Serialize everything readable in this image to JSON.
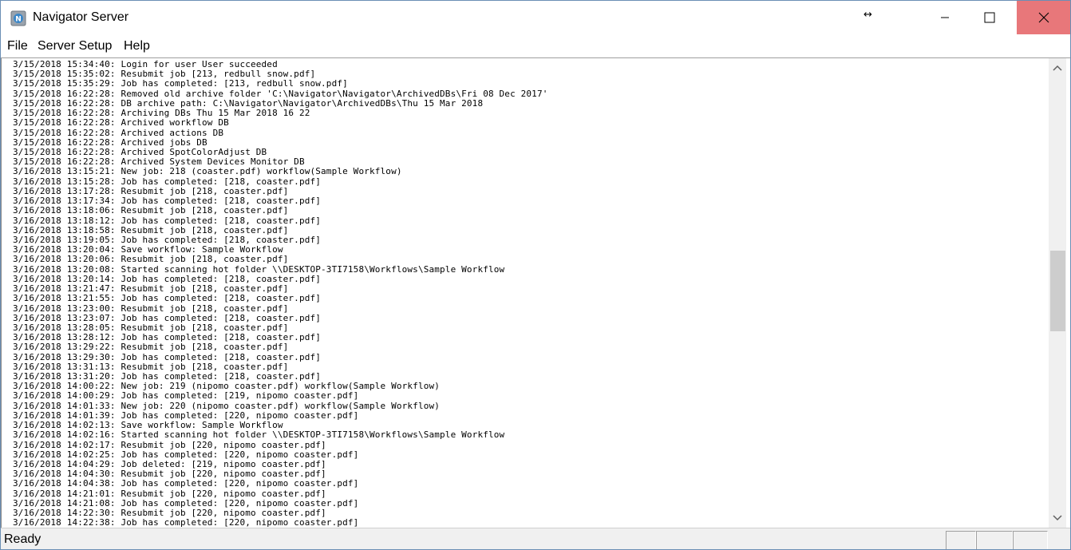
{
  "window": {
    "title": "Navigator Server"
  },
  "menu": {
    "items": [
      "File",
      "Server Setup",
      "Help"
    ]
  },
  "log": {
    "lines": [
      "3/15/2018 15:34:40: Login for user User succeeded",
      "3/15/2018 15:35:02: Resubmit job [213, redbull snow.pdf]",
      "3/15/2018 15:35:29: Job has completed: [213, redbull snow.pdf]",
      "3/15/2018 16:22:28: Removed old archive folder 'C:\\Navigator\\Navigator\\ArchivedDBs\\Fri 08 Dec 2017'",
      "3/15/2018 16:22:28: DB archive path: C:\\Navigator\\Navigator\\ArchivedDBs\\Thu 15 Mar 2018",
      "3/15/2018 16:22:28: Archiving DBs Thu 15 Mar 2018 16 22",
      "3/15/2018 16:22:28: Archived workflow DB",
      "3/15/2018 16:22:28: Archived actions DB",
      "3/15/2018 16:22:28: Archived jobs DB",
      "3/15/2018 16:22:28: Archived SpotColorAdjust DB",
      "3/15/2018 16:22:28: Archived System Devices Monitor DB",
      "3/16/2018 13:15:21: New job: 218 (coaster.pdf) workflow(Sample Workflow)",
      "3/16/2018 13:15:28: Job has completed: [218, coaster.pdf]",
      "3/16/2018 13:17:28: Resubmit job [218, coaster.pdf]",
      "3/16/2018 13:17:34: Job has completed: [218, coaster.pdf]",
      "3/16/2018 13:18:06: Resubmit job [218, coaster.pdf]",
      "3/16/2018 13:18:12: Job has completed: [218, coaster.pdf]",
      "3/16/2018 13:18:58: Resubmit job [218, coaster.pdf]",
      "3/16/2018 13:19:05: Job has completed: [218, coaster.pdf]",
      "3/16/2018 13:20:04: Save workflow: Sample Workflow",
      "3/16/2018 13:20:06: Resubmit job [218, coaster.pdf]",
      "3/16/2018 13:20:08: Started scanning hot folder \\\\DESKTOP-3TI7158\\Workflows\\Sample Workflow",
      "3/16/2018 13:20:14: Job has completed: [218, coaster.pdf]",
      "3/16/2018 13:21:47: Resubmit job [218, coaster.pdf]",
      "3/16/2018 13:21:55: Job has completed: [218, coaster.pdf]",
      "3/16/2018 13:23:00: Resubmit job [218, coaster.pdf]",
      "3/16/2018 13:23:07: Job has completed: [218, coaster.pdf]",
      "3/16/2018 13:28:05: Resubmit job [218, coaster.pdf]",
      "3/16/2018 13:28:12: Job has completed: [218, coaster.pdf]",
      "3/16/2018 13:29:22: Resubmit job [218, coaster.pdf]",
      "3/16/2018 13:29:30: Job has completed: [218, coaster.pdf]",
      "3/16/2018 13:31:13: Resubmit job [218, coaster.pdf]",
      "3/16/2018 13:31:20: Job has completed: [218, coaster.pdf]",
      "3/16/2018 14:00:22: New job: 219 (nipomo coaster.pdf) workflow(Sample Workflow)",
      "3/16/2018 14:00:29: Job has completed: [219, nipomo coaster.pdf]",
      "3/16/2018 14:01:33: New job: 220 (nipomo coaster.pdf) workflow(Sample Workflow)",
      "3/16/2018 14:01:39: Job has completed: [220, nipomo coaster.pdf]",
      "3/16/2018 14:02:13: Save workflow: Sample Workflow",
      "3/16/2018 14:02:16: Started scanning hot folder \\\\DESKTOP-3TI7158\\Workflows\\Sample Workflow",
      "3/16/2018 14:02:17: Resubmit job [220, nipomo coaster.pdf]",
      "3/16/2018 14:02:25: Job has completed: [220, nipomo coaster.pdf]",
      "3/16/2018 14:04:29: Job deleted: [219, nipomo coaster.pdf]",
      "3/16/2018 14:04:30: Resubmit job [220, nipomo coaster.pdf]",
      "3/16/2018 14:04:38: Job has completed: [220, nipomo coaster.pdf]",
      "3/16/2018 14:21:01: Resubmit job [220, nipomo coaster.pdf]",
      "3/16/2018 14:21:08: Job has completed: [220, nipomo coaster.pdf]",
      "3/16/2018 14:22:30: Resubmit job [220, nipomo coaster.pdf]",
      "3/16/2018 14:22:38: Job has completed: [220, nipomo coaster.pdf]"
    ]
  },
  "status": {
    "text": "Ready"
  },
  "icons": {
    "app": "navigator-app-icon",
    "minimize": "minimize-icon",
    "maximize": "maximize-icon",
    "close": "close-icon",
    "resize": "resize-horizontal-icon",
    "scroll_up": "chevron-up-icon",
    "scroll_down": "chevron-down-icon"
  },
  "colors": {
    "close_button_bg": "#e8777a",
    "window_border": "#6b8fb5",
    "scroll_thumb": "#cdcdcd"
  }
}
